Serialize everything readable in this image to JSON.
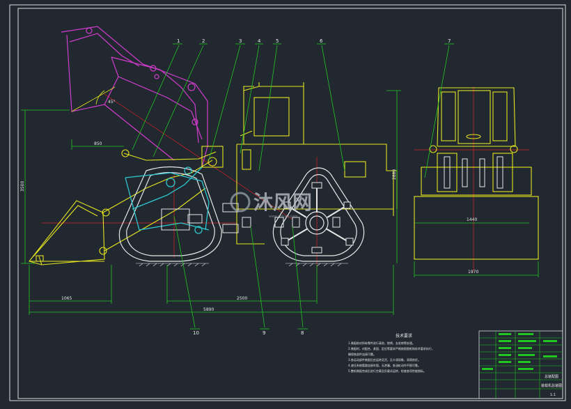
{
  "part_numbers": [
    "1",
    "2",
    "3",
    "4",
    "5",
    "6",
    "7",
    "8",
    "9",
    "10"
  ],
  "dimensions": {
    "d850": "850",
    "d3500": "3500",
    "d2880": "2880",
    "d1065": "1065",
    "d2500": "2500",
    "d5890": "5890",
    "d1440": "1440",
    "d1970": "1970",
    "angle": "45°"
  },
  "notes": {
    "title": "技术要求",
    "lines": [
      "1.装配前对所有零件进行清洗，除锈，去毛刺等处理。",
      "2.装配时，对配合、紧固、定位等要求严格按照图纸和技术要求执行，",
      "  确保各部件连接可靠。",
      "3.各运动部件装配后应运转灵活，无卡滞现象，润滑良好。",
      "4.液压系统管路连接牢固，无渗漏，各油缸动作平稳可靠。",
      "5.整机装配完成后进行空载及负载试运转，检查各项性能指标。"
    ]
  },
  "watermark": {
    "text": "沐风网",
    "sub": "www.mfcad.com"
  },
  "title_block": {
    "name": "总装配图",
    "sub": "装载机总装图",
    "code": "1:1"
  },
  "colors": {
    "bg": "#212830",
    "yellow": "#e6e61e",
    "green": "#22c622",
    "magenta": "#d23ccd",
    "cyan": "#2ec8d2",
    "white": "#e8e8e8",
    "red": "#e02020"
  }
}
